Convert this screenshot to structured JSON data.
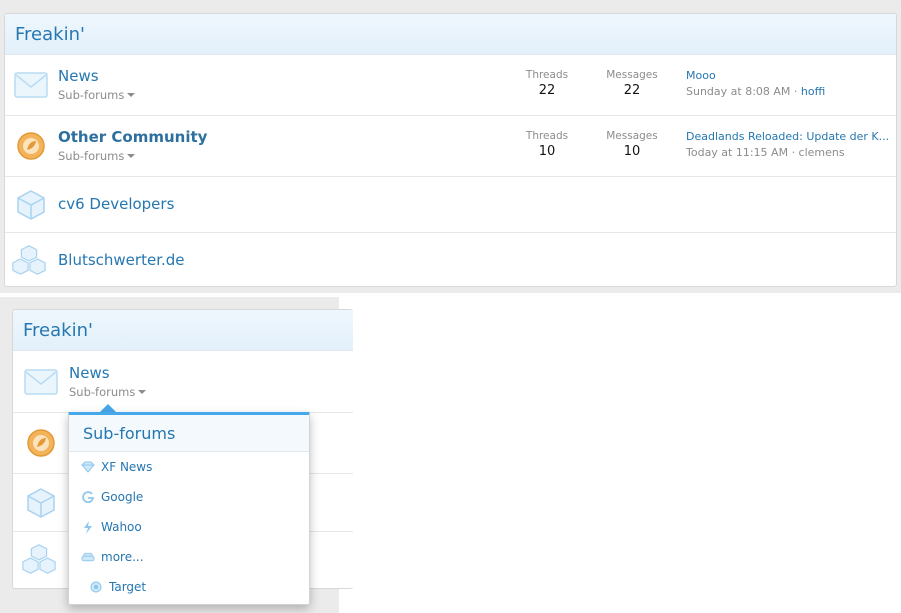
{
  "top": {
    "section_title": "Freakin'",
    "forums": [
      {
        "title": "News",
        "subforums_label": "Sub-forums",
        "threads_label": "Threads",
        "threads": "22",
        "messages_label": "Messages",
        "messages": "22",
        "last_title": "Mooo",
        "last_meta": "Sunday at 8:08 AM ·",
        "last_user": "hoffi",
        "icon": "envelope-icon"
      },
      {
        "title": "Other Community",
        "subforums_label": "Sub-forums",
        "threads_label": "Threads",
        "threads": "10",
        "messages_label": "Messages",
        "messages": "10",
        "last_title": "Deadlands Reloaded: Update der K...",
        "last_meta": "Today at 11:15 AM · clemens",
        "icon": "orange-leaf-badge-icon"
      },
      {
        "title": "cv6 Developers",
        "icon": "cube-icon"
      },
      {
        "title": "Blutschwerter.de",
        "icon": "stacked-cubes-icon"
      }
    ]
  },
  "bottom": {
    "section_title": "Freakin'",
    "forum_title": "News",
    "subforums_label": "Sub-forums",
    "menu": {
      "header": "Sub-forums",
      "items": [
        {
          "label": "XF News",
          "icon": "diamond-icon"
        },
        {
          "label": "Google",
          "icon": "google-icon"
        },
        {
          "label": "Wahoo",
          "icon": "bolt-icon"
        },
        {
          "label": "more...",
          "icon": "couch-icon"
        },
        {
          "label": "Target",
          "icon": "target-icon"
        }
      ]
    }
  },
  "colors": {
    "link": "#2577b1",
    "accent": "#47a7eb",
    "muted": "#8c8c8c",
    "header_bg": "#eaf4fc"
  }
}
